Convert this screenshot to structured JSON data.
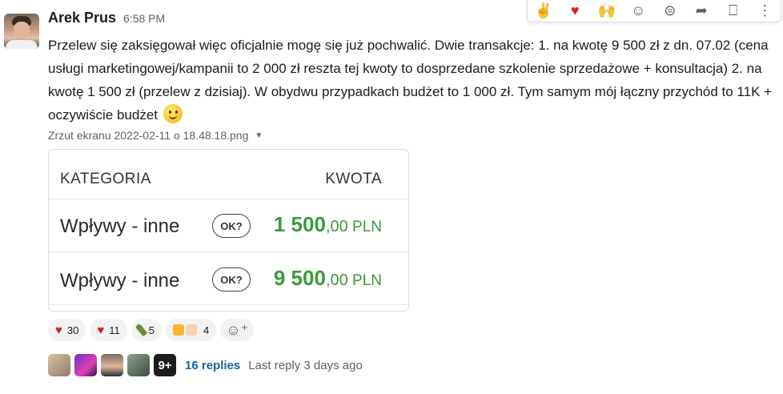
{
  "message": {
    "author": "Arek Prus",
    "time": "6:58 PM",
    "text": "Przelew się zaksięgował więc oficjalnie mogę się już pochwalić. Dwie transakcje: 1. na kwotę 9 500 zł z dn. 07.02 (cena usługi marketingowej/kampanii to 2 000 zł reszta tej kwoty to dosprzedane szkolenie sprzedażowe + konsultacja) 2. na kwotę 1 500 zł (przelew z dzisiaj). W obydwu przypadkach budżet to 1 000 zł. Tym samym mój łączny przychód to 11K + oczywiście budżet",
    "emoji": "slightly-smiling-face"
  },
  "attachment": {
    "filename": "Zrzut ekranu 2022-02-11 o 18.48.18.png",
    "table": {
      "headers": [
        "KATEGORIA",
        "KWOTA"
      ],
      "rows": [
        {
          "category": "Wpływy - inne",
          "badge": "OK?",
          "amount_int": "1 500",
          "amount_dec": ",00",
          "currency": " PLN"
        },
        {
          "category": "Wpływy - inne",
          "badge": "OK?",
          "amount_int": "9 500",
          "amount_dec": ",00",
          "currency": " PLN"
        }
      ]
    }
  },
  "reactions": [
    {
      "icon": "heart-icon",
      "count": "30"
    },
    {
      "icon": "heart-icon",
      "count": "11"
    },
    {
      "icon": "champagne-icon",
      "count": "5"
    },
    {
      "icon": "thumbs-up-icon",
      "count": "4"
    }
  ],
  "thread": {
    "more_label": "9+",
    "replies": "16 replies",
    "last_reply": "Last reply 3 days ago"
  },
  "toolbar": {
    "icons": [
      "victory-hand-icon",
      "heart-icon",
      "raised-hands-icon",
      "add-reaction-icon",
      "reply-in-thread-icon",
      "share-icon",
      "bookmark-icon",
      "more-actions-icon"
    ]
  },
  "colors": {
    "link": "#1264a3",
    "amount_green": "#3b9a3b",
    "heart": "#e01e1e"
  }
}
